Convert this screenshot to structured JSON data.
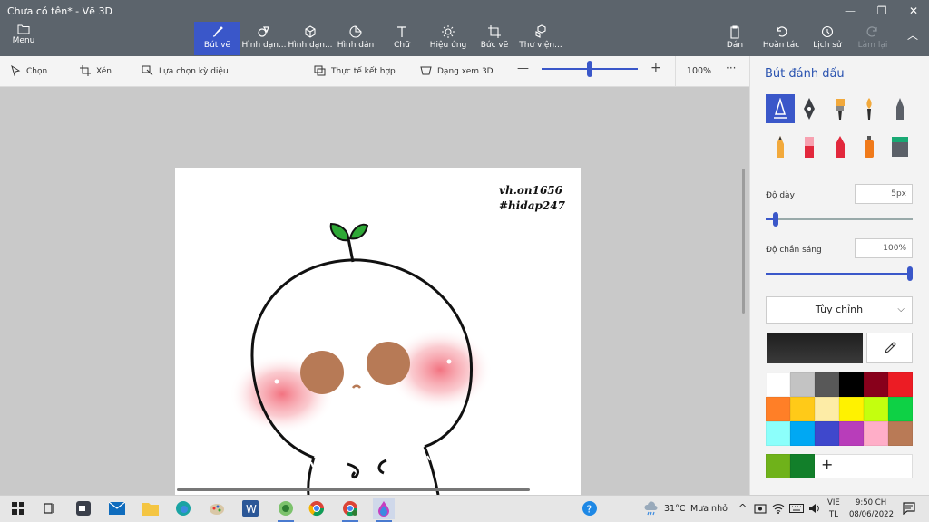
{
  "window": {
    "title": "Chưa có tên* - Vẽ 3D"
  },
  "ribbon": {
    "menu_label": "Menu",
    "tools": [
      {
        "label": "Bút vẽ",
        "icon": "brush-icon"
      },
      {
        "label": "Hình dạn...",
        "icon": "shapes-2d-icon"
      },
      {
        "label": "Hình dạn...",
        "icon": "shapes-3d-icon"
      },
      {
        "label": "Hình dán",
        "icon": "sticker-icon"
      },
      {
        "label": "Chữ",
        "icon": "text-icon"
      },
      {
        "label": "Hiệu ứng",
        "icon": "effects-icon"
      },
      {
        "label": "Bức vẽ",
        "icon": "canvas-icon"
      },
      {
        "label": "Thư viện...",
        "icon": "library-icon"
      }
    ],
    "paste_label": "Dán",
    "undo_label": "Hoàn tác",
    "history_label": "Lịch sử",
    "redo_label": "Làm lại"
  },
  "commandbar": {
    "select_label": "Chọn",
    "crop_label": "Xén",
    "magic_select_label": "Lựa chọn kỳ diệu",
    "mixed_reality_label": "Thực tế kết hợp",
    "view_3d_label": "Dạng xem 3D",
    "zoom_value": "100%",
    "zoom_level": 0.5
  },
  "canvas": {
    "watermark_line1": "vh.on1656",
    "watermark_line2": "#h​idap247"
  },
  "panel": {
    "title": "Bút đánh dấu",
    "brushes": [
      "marker-icon",
      "calligraphy-pen-icon",
      "oil-brush-icon",
      "watercolor-icon",
      "pixel-pen-icon",
      "pencil-icon",
      "eraser-icon",
      "crayon-icon",
      "spray-can-icon",
      "fill-bucket-icon"
    ],
    "thickness_label": "Độ dày",
    "thickness_value": "5px",
    "thickness_level": 0.05,
    "opacity_label": "Độ chắn sáng",
    "opacity_value": "100%",
    "opacity_level": 1.0,
    "finish_label": "Tùy chỉnh",
    "current_color": "#2a2a2a",
    "palette": [
      "#ffffff",
      "#c3c3c3",
      "#585858",
      "#000000",
      "#88001b",
      "#ec1c24",
      "#ff7f27",
      "#ffca18",
      "#fdeca6",
      "#fff200",
      "#c4ff0e",
      "#0ed145",
      "#8cfffb",
      "#00a8f3",
      "#3f48cc",
      "#b83dba",
      "#ffaec8",
      "#b97a56"
    ],
    "custom_colors": [
      "#6fb21a",
      "#127f2a"
    ]
  },
  "taskbar": {
    "weather_temp": "31°C",
    "weather_desc": "Mưa nhỏ",
    "lang_top": "VIE",
    "lang_bottom": "TL",
    "time": "9:50 CH",
    "date": "08/06/2022"
  }
}
